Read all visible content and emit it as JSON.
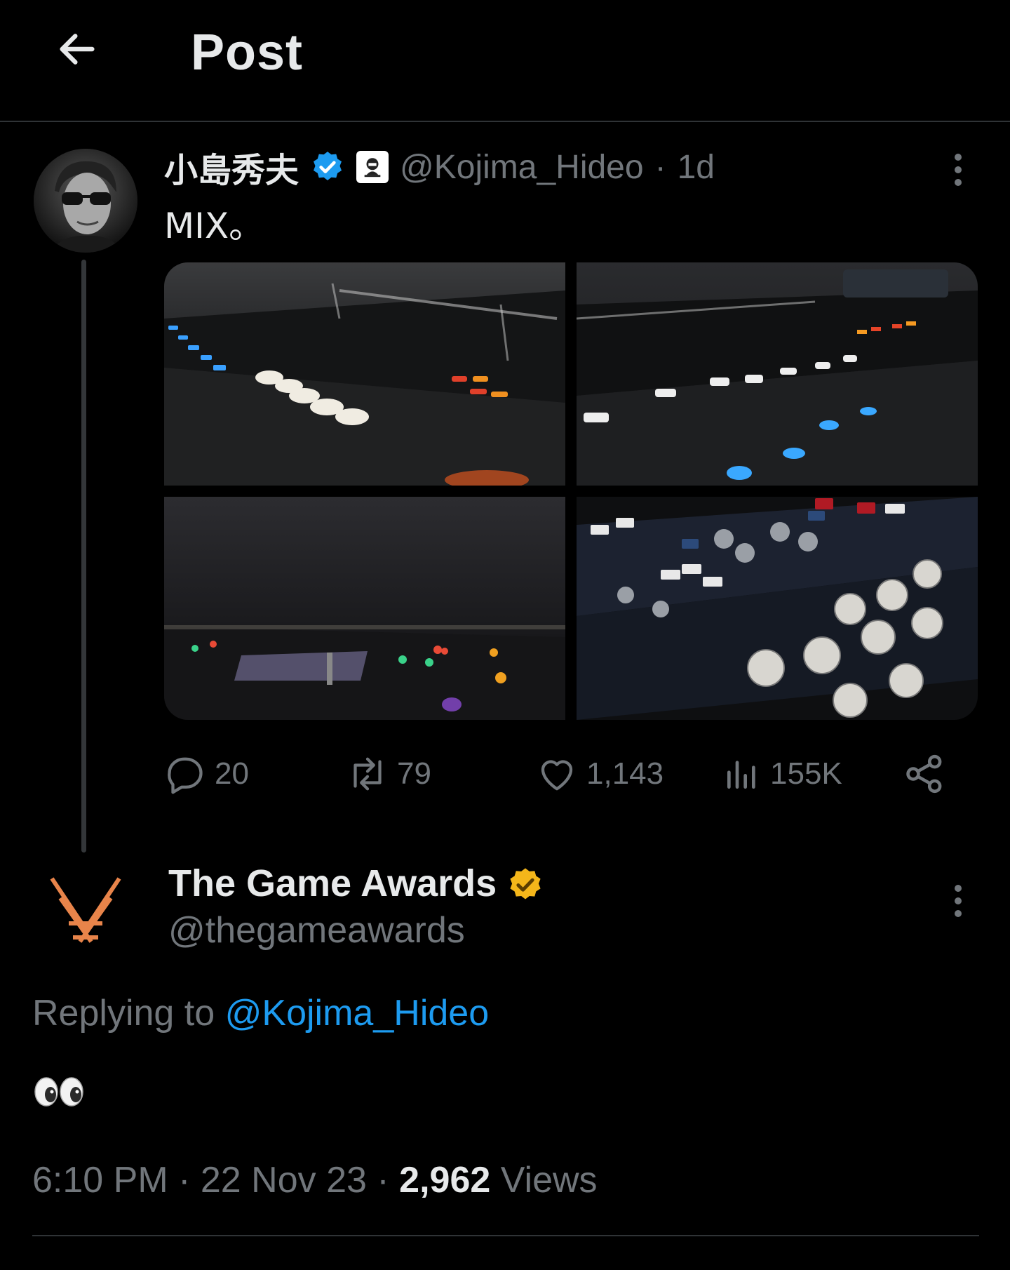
{
  "header": {
    "title": "Post",
    "back_icon": "arrow-left-icon"
  },
  "tweet": {
    "author_name": "小島秀夫",
    "handle": "@Kojima_Hideo",
    "separator": "·",
    "time_ago": "1d",
    "text": "MIX。",
    "verified_color": "#1d9bf0",
    "media_count": 4,
    "stats": {
      "replies": "20",
      "reposts": "79",
      "likes": "1,143",
      "views": "155K"
    }
  },
  "reply": {
    "author_name": "The Game Awards",
    "handle": "@thegameawards",
    "verified_color": "#f4b61a",
    "replying_prefix": "Replying to",
    "replying_to": "@Kojima_Hideo",
    "text": "👀",
    "time": "6:10 PM",
    "sep1": "·",
    "date": "22 Nov 23",
    "sep2": "·",
    "views_count": "2,962",
    "views_label": "Views"
  },
  "colors": {
    "background": "#000000",
    "text_primary": "#e7e9ea",
    "text_secondary": "#71767b",
    "link": "#1d9bf0",
    "divider": "#2f3336",
    "brand_orange": "#e8844a"
  }
}
